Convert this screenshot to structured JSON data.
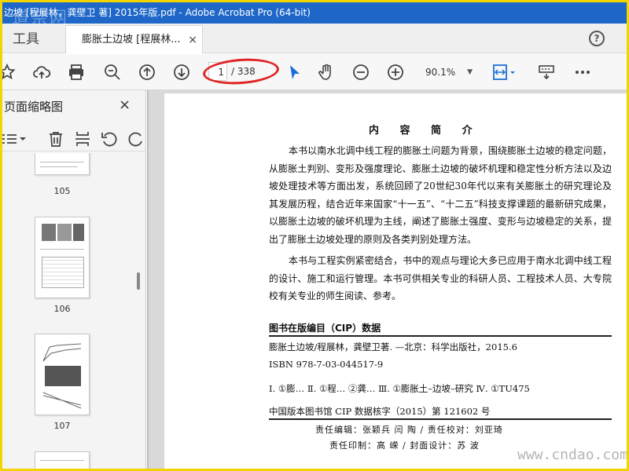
{
  "window": {
    "title": "边坡 [程展林，龚壁卫 著] 2015年版.pdf - Adobe Acrobat Pro (64-bit)",
    "watermark_top": "道奈网"
  },
  "tabs": {
    "tools_label": "工具",
    "document_label": "膨胀土边坡 [程展林...",
    "close_glyph": "×",
    "help_glyph": "?"
  },
  "toolbar": {
    "page_current": "1",
    "page_total": "/ 338",
    "zoom": "90.1%",
    "icons": [
      "star-icon",
      "cloud-upload-icon",
      "print-icon",
      "zoom-out-magnifier-icon",
      "page-up-icon",
      "page-down-icon",
      "select-arrow-icon",
      "hand-icon",
      "zoom-minus-icon",
      "zoom-plus-icon",
      "fit-page-icon",
      "scroll-mode-icon",
      "more-icon"
    ]
  },
  "left_panel": {
    "title": "页面缩略图",
    "close_glyph": "×",
    "thumbnails": [
      {
        "label": "105"
      },
      {
        "label": "106"
      },
      {
        "label": "107"
      }
    ]
  },
  "document": {
    "heading": "内 容 简 介",
    "paragraph1": "本书以南水北调中线工程的膨胀土问题为背景，围绕膨胀土边坡的稳定问题，从膨胀土判别、变形及强度理论、膨胀土边坡的破坏机理和稳定性分析方法以及边坡处理技术等方面出发，系统回顾了20世纪30年代以来有关膨胀土的研究理论及其发展历程，结合近年来国家“十一五”、“十二五”科技支撑课题的最新研究成果，以膨胀土边坡的破坏机理为主线，阐述了膨胀土强度、变形与边坡稳定的关系，提出了膨胀土边坡处理的原则及各类判别处理方法。",
    "paragraph2": "本书与工程实例紧密结合，书中的观点与理论大多已应用于南水北调中线工程的设计、施工和运行管理。本书可供相关专业的科研人员、工程技术人员、大专院校有关专业的师生阅读、参考。",
    "cip_heading": "图书在版编目（CIP）数据",
    "cip_book": "膨胀土边坡/程展林，龚壁卫著. —北京：科学出版社，2015.6",
    "cip_isbn": "ISBN 978-7-03-044517-9",
    "cip_class": "Ⅰ. ①膨…   Ⅱ. ①程…  ②龚…   Ⅲ. ①膨胀土–边坡–研究   Ⅳ. ①TU475",
    "cip_number": "中国版本图书馆 CIP 数据核字（2015）第 121602 号",
    "credit1": "责任编辑：张颖兵  闫  陶 / 责任校对：刘亚琦",
    "credit2": "责任印制：高  嵘 / 封面设计：苏  波"
  },
  "watermark_bottom": "www.cndao.com"
}
